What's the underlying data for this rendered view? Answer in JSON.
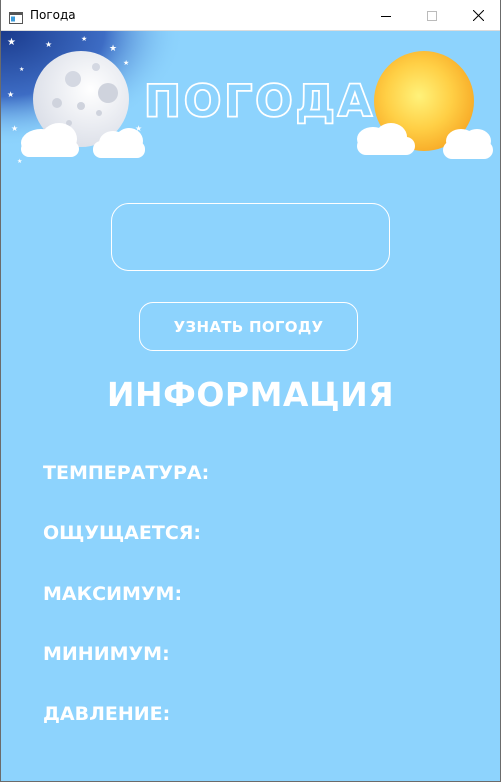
{
  "window": {
    "title": "Погода"
  },
  "header": {
    "app_title": "ПОГОДА"
  },
  "form": {
    "city_value": "",
    "button_label": "УЗНАТЬ ПОГОДУ"
  },
  "info": {
    "title": "ИНФОРМАЦИЯ",
    "rows": [
      {
        "label": "ТЕМПЕРАТУРА:"
      },
      {
        "label": "ОЩУЩАЕТСЯ:"
      },
      {
        "label": "МАКСИМУМ:"
      },
      {
        "label": "МИНИМУМ:"
      },
      {
        "label": "ДАВЛЕНИЕ:"
      }
    ]
  },
  "colors": {
    "background": "#8dd3fd",
    "night_sky": "#1a3a8c",
    "sun": "#ffc533",
    "text": "#ffffff"
  }
}
